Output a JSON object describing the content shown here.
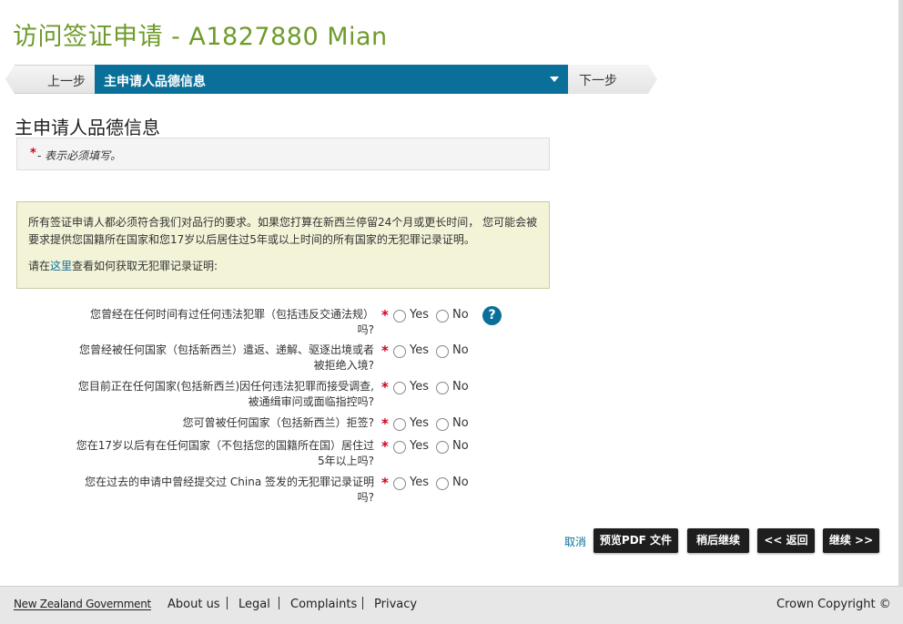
{
  "header": {
    "title": "访问签证申请 - A1827880 Mian"
  },
  "step_nav": {
    "prev_label": "上一步",
    "current_step": "主申请人品德信息",
    "next_label": "下一步"
  },
  "section": {
    "heading": "主申请人品德信息",
    "required_star": "*",
    "required_note": "- 表示必须填写。"
  },
  "info": {
    "paragraph1": "所有签证申请人都必须符合我们对品行的要求。如果您打算在新西兰停留24个月或更长时间， 您可能会被要求提供您国籍所在国家和您17岁以后居住过5年或以上时间的所有国家的无犯罪记录证明。",
    "paragraph2_pre": "请在",
    "paragraph2_link": "这里",
    "paragraph2_post": "查看如何获取无犯罪记录证明:"
  },
  "questions": [
    {
      "text": "您曾经在任何时间有过任何违法犯罪（包括违反交通法规）吗?",
      "yes": "Yes",
      "no": "No"
    },
    {
      "text": "您曾经被任何国家（包括新西兰）遣返、递解、驱逐出境或者被拒绝入境?",
      "yes": "Yes",
      "no": "No"
    },
    {
      "text": "您目前正在任何国家(包括新西兰)因任何违法犯罪而接受调查, 被通缉审问或面临指控吗?",
      "yes": "Yes",
      "no": "No"
    },
    {
      "text": "您可曾被任何国家（包括新西兰）拒签?",
      "yes": "Yes",
      "no": "No"
    },
    {
      "text": "您在17岁以后有在任何国家（不包括您的国籍所在国）居住过5年以上吗?",
      "yes": "Yes",
      "no": "No"
    },
    {
      "text": "您在过去的申请中曾经提交过 China 签发的无犯罪记录证明吗?",
      "yes": "Yes",
      "no": "No"
    }
  ],
  "help_icon": "?",
  "actions": {
    "cancel": "取消",
    "preview_pdf": "预览PDF 文件",
    "save_later": "稍后继续",
    "back": "<< 返回",
    "continue": "继续 >>"
  },
  "footer": {
    "gov_logo": "New Zealand Government",
    "links": [
      "About us",
      "Legal",
      "Complaints",
      "Privacy"
    ],
    "copyright": "Crown Copyright ©"
  },
  "colors": {
    "title_green": "#6f9b2b",
    "step_blue": "#0a7099",
    "required_red": "#d0021b",
    "info_bg": "#f3f3d8"
  }
}
